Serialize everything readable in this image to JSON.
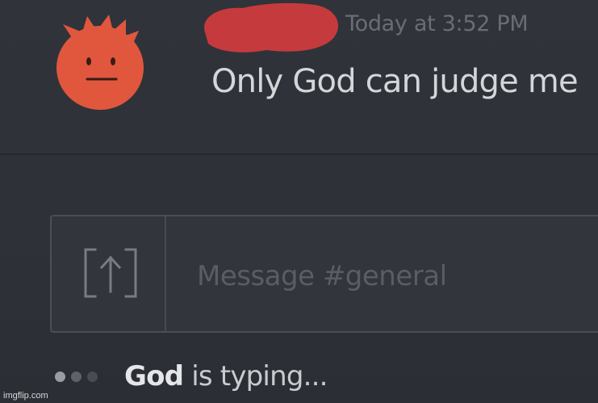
{
  "message": {
    "timestamp": "Today at 3:52 PM",
    "text": "Only God can judge me"
  },
  "composer": {
    "placeholder": "Message #general",
    "upload_icon": "upload-icon"
  },
  "typing_indicator": {
    "name": "God",
    "suffix": " is typing..."
  },
  "watermark": "imgflip.com",
  "colors": {
    "background": "#2f3239",
    "avatar": "#e0573e",
    "redaction": "#c53a3d",
    "timestamp": "#6a6d74",
    "message_text": "#d4d6d9",
    "placeholder": "#5a5d64"
  }
}
